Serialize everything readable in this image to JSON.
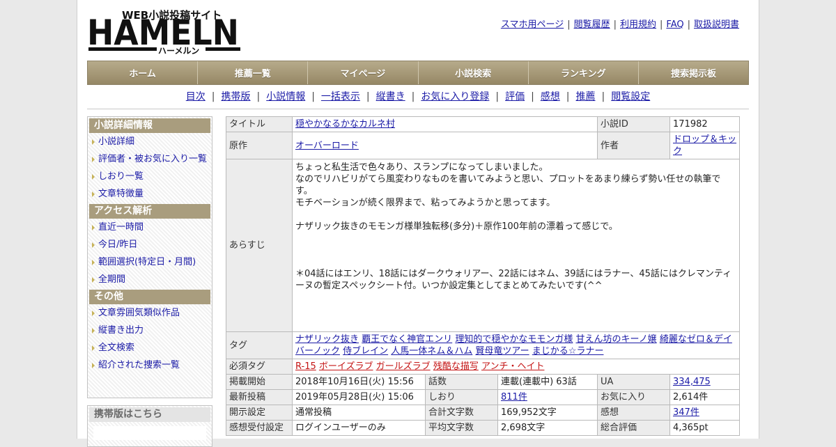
{
  "logo": {
    "main": "HAMELN",
    "tagline": "WEB小説投稿サイト",
    "kana": "ハーメルン"
  },
  "top_links": [
    "スマホ用ページ",
    "閲覧履歴",
    "利用規約",
    "FAQ",
    "取扱説明書"
  ],
  "nav": [
    "ホーム",
    "推薦一覧",
    "マイページ",
    "小説検索",
    "ランキング",
    "捜索掲示板"
  ],
  "subnav": [
    "目次",
    "携帯版",
    "小説情報",
    "一括表示",
    "縦書き",
    "お気に入り登録",
    "評価",
    "感想",
    "推薦",
    "閲覧設定"
  ],
  "sidebar": {
    "sections": [
      {
        "title": "小説詳細情報",
        "items": [
          "小説詳細",
          "評価者・被お気に入り一覧",
          "しおり一覧",
          "文章特徴量"
        ]
      },
      {
        "title": "アクセス解析",
        "items": [
          "直近一時間",
          "今日/昨日",
          "範囲選択(特定日・月間)",
          "全期間"
        ]
      },
      {
        "title": "その他",
        "items": [
          "文章雰囲気類似作品",
          "縦書き出力",
          "全文検索",
          "紹介された捜索一覧"
        ]
      }
    ],
    "mobile_title": "携帯版はこちら"
  },
  "info": {
    "title_label": "タイトル",
    "title": "穏やかなるかなカルネ村",
    "id_label": "小説ID",
    "id": "171982",
    "original_label": "原作",
    "original": "オーバーロード",
    "author_label": "作者",
    "author": "ドロップ＆キック",
    "synopsis_label": "あらすじ",
    "synopsis": "ちょっと私生活で色々あり、スランプになってしまいました。\nなのでリハビリがてら風変わりなものを書いてみようと思い、プロットをあまり練らず勢い任せの執筆です。\nモチベーションが続く限界まで、粘ってみようかと思ってます。\n\nナザリック抜きのモモンガ様単独転移(多分)＋原作100年前の漂着って感じで。\n\n\n\n＊04話にはエンリ、18話にはダークウォリアー、22話にはネム、39話にはラナー、45話にはクレマンティーヌの暫定スペックシート付。いつか設定集としてまとめてみたいです(^^",
    "tags_label": "タグ",
    "tags": [
      "ナザリック抜き",
      "覇王でなく神官エンリ",
      "理知的で穏やかなモモンガ様",
      "甘えん坊のキーノ嬢",
      "綺麗なゼロ＆デイバーノック",
      "侍ブレイン",
      "人馬一体ネム＆ハム",
      "賢母竜ツアー",
      "まじかる☆ラナー"
    ],
    "req_tags_label": "必須タグ",
    "req_tags": [
      "R-15",
      "ボーイズラブ",
      "ガールズラブ",
      "残酷な描写",
      "アンチ・ヘイト"
    ],
    "stats": [
      [
        "掲載開始",
        "2018年10月16日(火) 15:56",
        "話数",
        "連載(連載中) 63話",
        "UA",
        "334,475"
      ],
      [
        "最新投稿",
        "2019年05月28日(火) 15:06",
        "しおり",
        "811件",
        "お気に入り",
        "2,614件"
      ],
      [
        "開示設定",
        "通常投稿",
        "合計文字数",
        "169,952文字",
        "感想",
        "347件"
      ],
      [
        "感想受付設定",
        "ログインユーザーのみ",
        "平均文字数",
        "2,698文字",
        "総合評価",
        "4,365pt"
      ]
    ]
  }
}
